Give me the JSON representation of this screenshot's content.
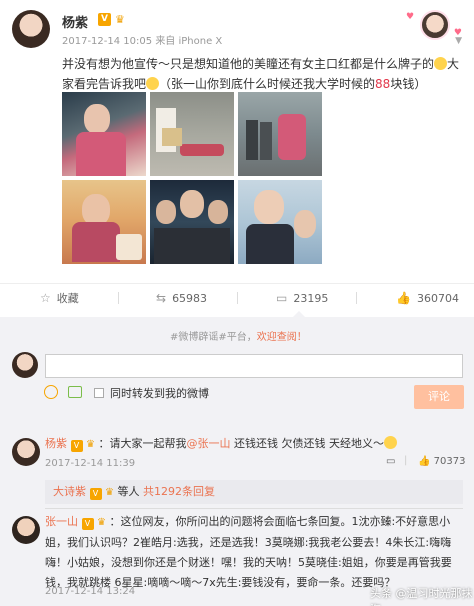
{
  "post": {
    "username": "杨紫",
    "vip_badge": "V",
    "timestamp": "2017-12-14 10:05",
    "source": "来自 iPhone X",
    "text_part1": "并没有想为他宣传～只是想知道他的美瞳还有女主口红都是什么牌子的",
    "text_part2": "大家看完告诉我吧",
    "text_part3": "（张一山你到底什么时候还我大学时候的",
    "text_money": "88",
    "text_part4": "块钱）"
  },
  "actions": {
    "collect_label": "收藏",
    "repost_count": "65983",
    "comment_count": "23195",
    "like_count": "360704"
  },
  "comment_box": {
    "notice_prefix": "#微博辟谣#平台，",
    "notice_link": "欢迎查阅！",
    "repost_checkbox_label": "同时转发到我的微博",
    "submit_label": "评论"
  },
  "comments": [
    {
      "name": "杨紫",
      "badge": "V",
      "text_prefix": "：请大家一起帮我",
      "mention": "@张一山",
      "text_suffix": " 还钱还钱 欠债还钱 天经地义～",
      "time": "2017-12-14 11:39",
      "likes": "70373"
    },
    {
      "name": "张一山",
      "badge": "V",
      "text": "：这位网友，你所问出的问题将会面临七条回复。1沈亦臻:不好意思小姐，我们认识吗？2崔皓月:选我，还是选我！3莫晓娜:我我老公要去！4朱长江:嗨嗨嗨！小姑娘，没想到你还是个财迷！嘿！我的天呐！5莫晓佳:姐姐，你要是再管我要钱，我就跳楼 6星星:嘀嘀～嘀～7x先生:要钱没有，要命一条。还要吗？",
      "time": "2017-12-14 13:24"
    }
  ],
  "sub_reply": {
    "name": "大诗紫",
    "badge": "V",
    "text": "等人",
    "more": "共1292条回复"
  },
  "watermark": "头条 @温习时光那抹海",
  "colors": {
    "accent": "#eb7350",
    "badge": "#f7a500",
    "submit_bg": "#ffc09f"
  }
}
